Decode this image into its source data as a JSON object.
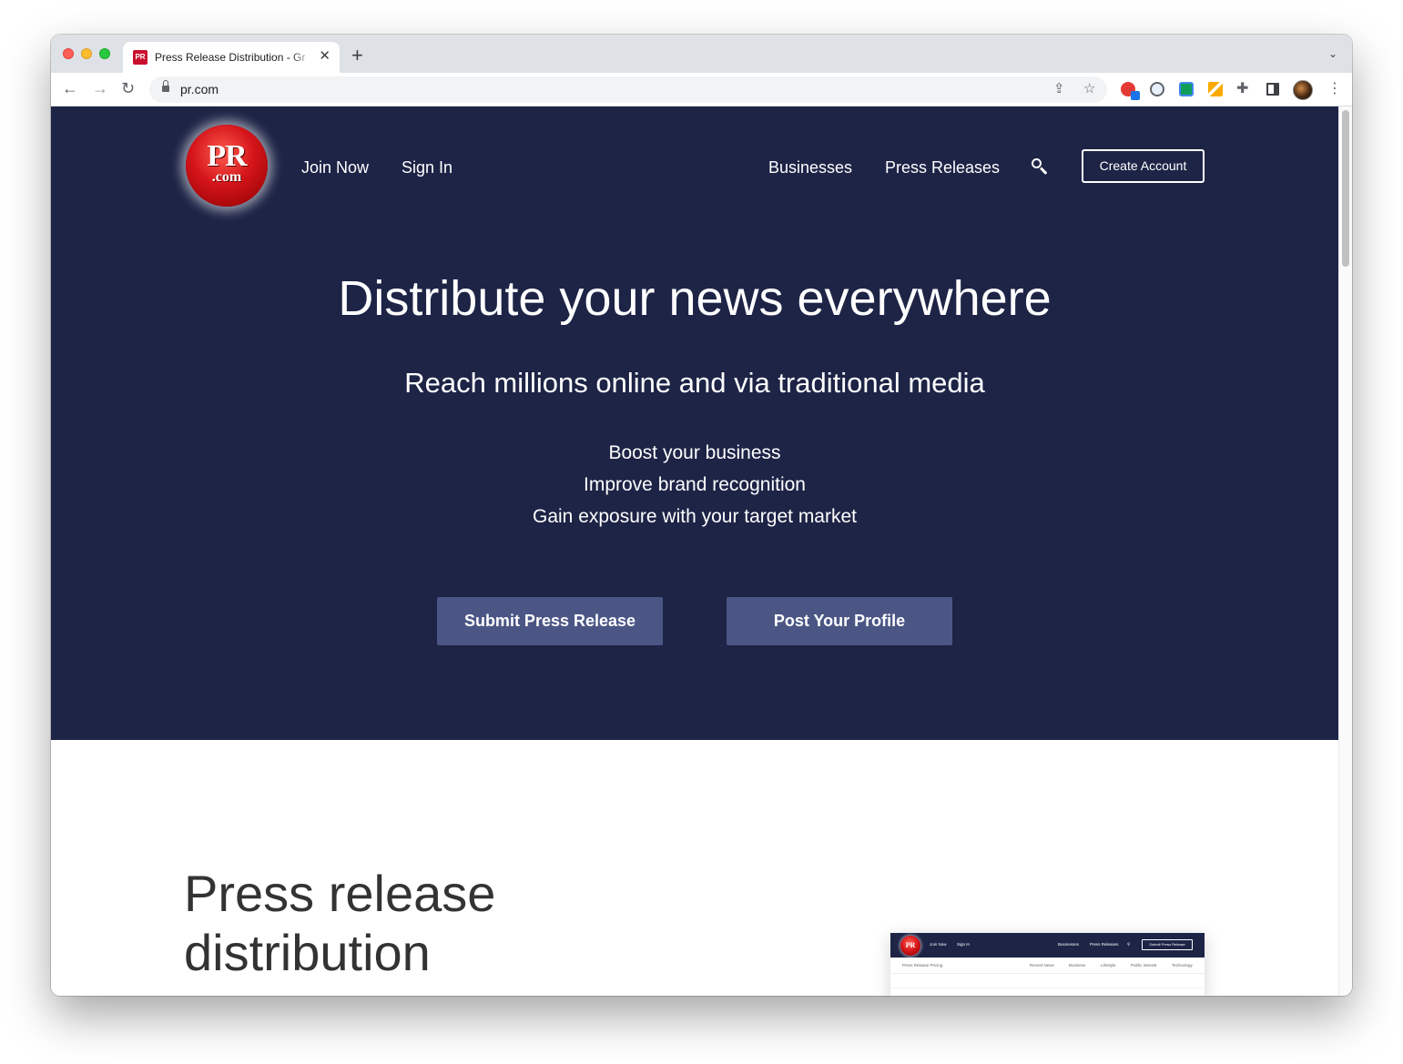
{
  "browser": {
    "tab_title": "Press Release Distribution - Gr",
    "tab_favicon_text": "PR",
    "tab_close": "✕",
    "new_tab": "+",
    "tab_menu": "⌄",
    "back": "←",
    "forward": "→",
    "reload": "↻",
    "url": "pr.com",
    "menu": "⋮"
  },
  "header": {
    "logo_main": "PR",
    "logo_sub": ".com",
    "join_now": "Join Now",
    "sign_in": "Sign In",
    "businesses": "Businesses",
    "press_releases": "Press Releases",
    "create_account": "Create Account"
  },
  "hero": {
    "title": "Distribute your news everywhere",
    "subtitle": "Reach millions online and via traditional media",
    "benefits": [
      "Boost your business",
      "Improve brand recognition",
      "Gain exposure with your target market"
    ],
    "submit_button": "Submit Press Release",
    "profile_button": "Post Your Profile"
  },
  "section": {
    "title": "Press release distribution"
  },
  "preview": {
    "logo": "PR",
    "join_now": "Join Now",
    "sign_in": "Sign In",
    "businesses": "Businesses",
    "press_releases": "Press Releases",
    "submit": "Submit Press Release",
    "pricing": "Press Release Pricing",
    "categories": [
      "Recent News",
      "Business",
      "Lifestyle",
      "Public Interest",
      "Technology"
    ]
  },
  "colors": {
    "hero_bg": "#1d2446",
    "cta_bg": "#4b5685",
    "logo_red": "#d4141a"
  }
}
